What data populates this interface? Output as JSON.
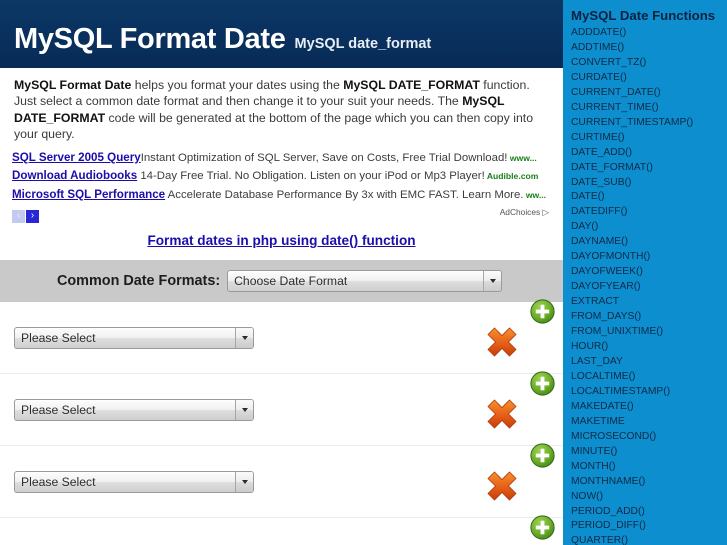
{
  "header": {
    "title": "MySQL Format Date",
    "subtitle": "MySQL date_format",
    "bg_color": "#0a3161"
  },
  "intro": {
    "segments": [
      {
        "text": "MySQL Format Date",
        "bold": true
      },
      {
        "text": " helps you format your dates using the ",
        "bold": false
      },
      {
        "text": "MySQL DATE_FORMAT",
        "bold": true
      },
      {
        "text": " function.  Just select a common date format and then change it to your suit your needs. The ",
        "bold": false
      },
      {
        "text": "MySQL DATE_FORMAT",
        "bold": true
      },
      {
        "text": " code will be generated at the bottom of the page which you can then copy into your query.",
        "bold": false
      }
    ]
  },
  "ads": {
    "items": [
      {
        "title": "SQL Server 2005 Query",
        "description": "Instant Optimization of SQL Server, Save on Costs, Free Trial Download!",
        "url": "www..."
      },
      {
        "title": "Download Audiobooks",
        "description": " 14-Day Free Trial. No Obligation. Listen on your iPod or Mp3 Player!",
        "url": "Audible.com"
      },
      {
        "title": "Microsoft SQL Performance",
        "description": " Accelerate Database Performance By 3x with EMC FAST. Learn More.",
        "url": "ww..."
      }
    ],
    "prev_label": "‹",
    "next_label": "›",
    "adchoices_label": "AdChoices ▷",
    "link_color": "#1a0dab",
    "url_color": "#1a7f1a"
  },
  "php_link": {
    "label": "Format dates in php using date() function"
  },
  "common_formats": {
    "label": "Common Date Formats:",
    "select_value": "Choose Date Format",
    "band_color": "#c9c9c9"
  },
  "format_rows": [
    {
      "select_value": "Please Select",
      "remove_label": "Remove",
      "add_label": "Add"
    },
    {
      "select_value": "Please Select",
      "remove_label": "Remove",
      "add_label": "Add"
    },
    {
      "select_value": "Please Select",
      "remove_label": "Remove",
      "add_label": "Add"
    }
  ],
  "sidebar": {
    "title": "MySQL Date Functions",
    "bg_color": "#0d8ecf",
    "functions": [
      "ADDDATE()",
      "ADDTIME()",
      "CONVERT_TZ()",
      "CURDATE()",
      "CURRENT_DATE()",
      "CURRENT_TIME()",
      "CURRENT_TIMESTAMP()",
      "CURTIME()",
      "DATE_ADD()",
      "DATE_FORMAT()",
      "DATE_SUB()",
      "DATE()",
      "DATEDIFF()",
      "DAY()",
      "DAYNAME()",
      "DAYOFMONTH()",
      "DAYOFWEEK()",
      "DAYOFYEAR()",
      "EXTRACT",
      "FROM_DAYS()",
      "FROM_UNIXTIME()",
      "HOUR()",
      "LAST_DAY",
      "LOCALTIME()",
      "LOCALTIMESTAMP()",
      "MAKEDATE()",
      "MAKETIME",
      "MICROSECOND()",
      "MINUTE()",
      "MONTH()",
      "MONTHNAME()",
      "NOW()",
      "PERIOD_ADD()",
      "PERIOD_DIFF()",
      "QUARTER()"
    ]
  }
}
